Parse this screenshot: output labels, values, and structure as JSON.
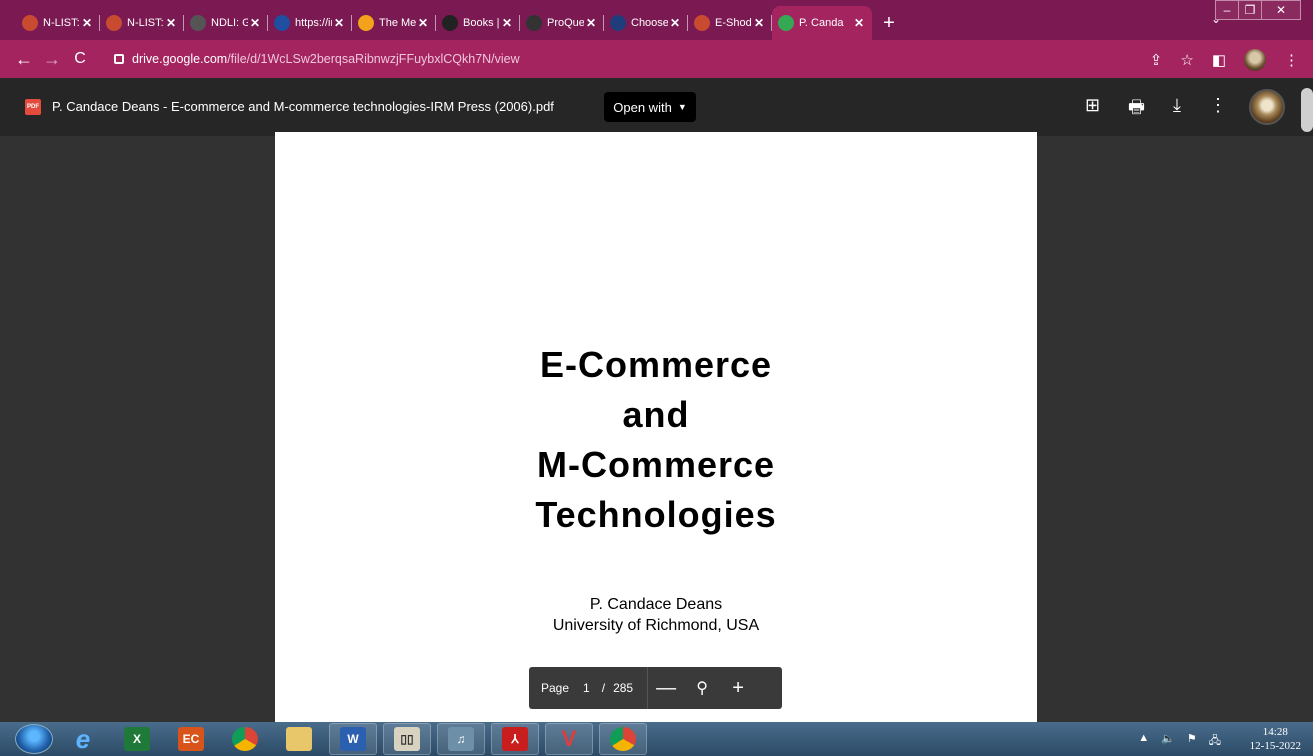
{
  "browser": {
    "tabs": [
      {
        "title": "N-LIST: N",
        "icon": "nlist-icon",
        "color": "#c84b31"
      },
      {
        "title": "N-LIST: N",
        "icon": "nlist-icon",
        "color": "#c84b31"
      },
      {
        "title": "NDLI: Gu",
        "icon": "ndli-icon",
        "color": "#555555"
      },
      {
        "title": "https://in",
        "icon": "ij-icon",
        "color": "#1f4fa0"
      },
      {
        "title": "The Merc",
        "icon": "mercury-icon",
        "color": "#f2a21b"
      },
      {
        "title": "Books | C",
        "icon": "books-icon",
        "color": "#222222"
      },
      {
        "title": "ProQuest",
        "icon": "proquest-icon",
        "color": "#333333"
      },
      {
        "title": "Choose D",
        "icon": "e-icon",
        "color": "#1f3d7a"
      },
      {
        "title": "E-Shodh",
        "icon": "eshodh-icon",
        "color": "#c84b31"
      },
      {
        "title": "P. Canda",
        "icon": "drive-icon",
        "color": "#34a853",
        "active": true
      }
    ],
    "url_host": "drive.google.com",
    "url_path": "/file/d/1WcLSw2berqsaRibnwzjFFuybxlCQkh7N/view",
    "accent": "#a4245f"
  },
  "viewer": {
    "file_badge": "PDF",
    "filename": "P. Candace Deans - E-commerce and M-commerce technologies-IRM Press (2006).pdf",
    "open_with": "Open with"
  },
  "page": {
    "title_lines": [
      "E-Commerce",
      "and",
      "M-Commerce",
      "Technologies"
    ],
    "author": "P. Candace Deans",
    "affiliation": "University of Richmond, USA"
  },
  "pager": {
    "label": "Page",
    "current": "1",
    "separator": "/",
    "total": "285"
  },
  "taskbar": {
    "time": "14:28",
    "date": "12-15-2022"
  }
}
